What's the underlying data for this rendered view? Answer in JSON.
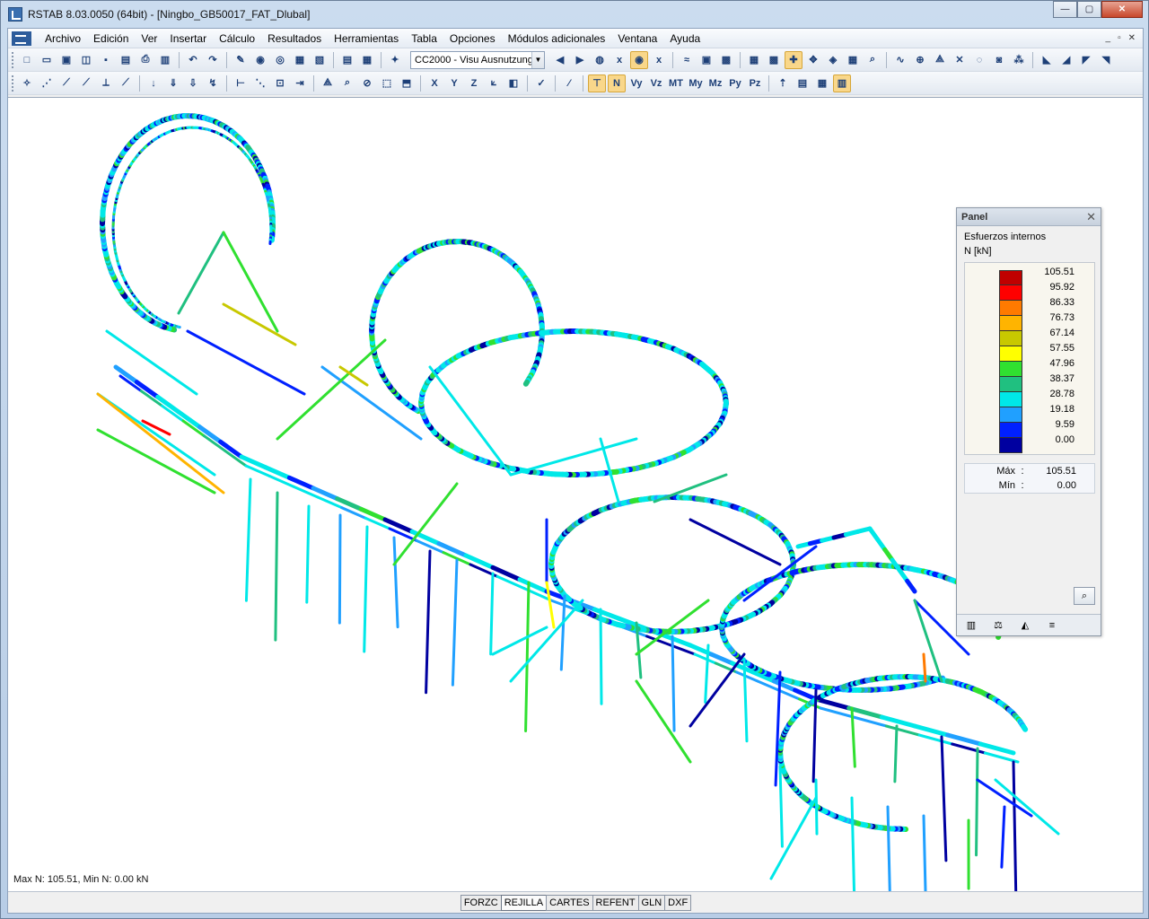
{
  "window": {
    "title": "RSTAB 8.03.0050 (64bit) - [Ningbo_GB50017_FAT_Dlubal]",
    "buttons": {
      "minimize": "—",
      "maximize": "▢",
      "close": "✕"
    }
  },
  "menu": {
    "items": [
      "Archivo",
      "Edición",
      "Ver",
      "Insertar",
      "Cálculo",
      "Resultados",
      "Herramientas",
      "Tabla",
      "Opciones",
      "Módulos adicionales",
      "Ventana",
      "Ayuda"
    ],
    "mdi_buttons": [
      "_",
      "▫",
      "✕"
    ]
  },
  "toolbar1": {
    "load_case_combo": "CC2000 - Visu Ausnutzung"
  },
  "toolbar2": {
    "force_buttons": [
      "N",
      "Vy",
      "Vz",
      "MT",
      "My",
      "Mz",
      "Py",
      "Pz"
    ]
  },
  "panel": {
    "title": "Panel",
    "close": "✕",
    "heading": "Esfuerzos internos",
    "unit": "N [kN]",
    "legend_values": [
      "105.51",
      "95.92",
      "86.33",
      "76.73",
      "67.14",
      "57.55",
      "47.96",
      "38.37",
      "28.78",
      "19.18",
      "9.59",
      "0.00"
    ],
    "legend_colors": [
      "#c00000",
      "#ff0000",
      "#ff7a00",
      "#ffb400",
      "#c8c800",
      "#ffff00",
      "#30e030",
      "#20c080",
      "#00e8e8",
      "#20a0ff",
      "#0020ff",
      "#0000a0"
    ],
    "max_label": "Máx",
    "max_value": "105.51",
    "min_label": "Mín",
    "min_value": "0.00",
    "colon": ":"
  },
  "viewport": {
    "status_text": "Max N: 105.51, Min N: 0.00 kN"
  },
  "statusbar": {
    "buttons": [
      "FORZC",
      "REJILLA",
      "CARTES",
      "REFENT",
      "GLN",
      "DXF"
    ],
    "active": "REJILLA"
  }
}
